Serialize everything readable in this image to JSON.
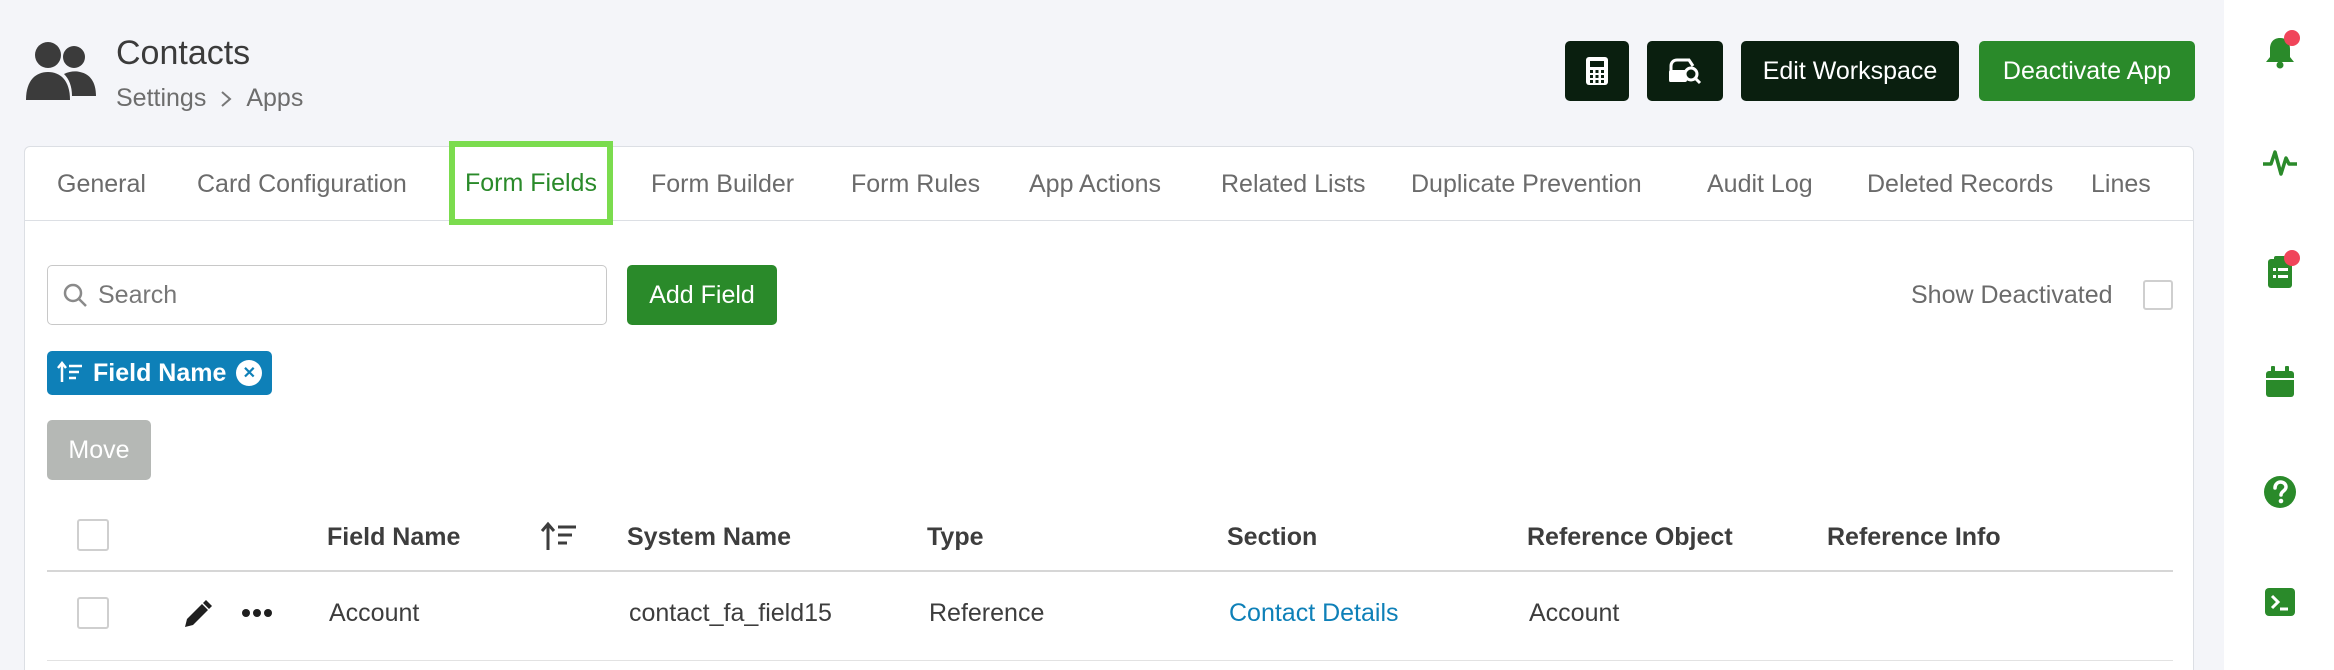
{
  "header": {
    "title": "Contacts",
    "breadcrumb": [
      "Settings",
      "Apps"
    ],
    "buttons": {
      "edit_workspace": "Edit Workspace",
      "deactivate_app": "Deactivate App"
    }
  },
  "tabs": [
    {
      "label": "General",
      "active": false
    },
    {
      "label": "Card Configuration",
      "active": false
    },
    {
      "label": "Form Fields",
      "active": true
    },
    {
      "label": "Form Builder",
      "active": false
    },
    {
      "label": "Form Rules",
      "active": false
    },
    {
      "label": "App Actions",
      "active": false
    },
    {
      "label": "Related Lists",
      "active": false
    },
    {
      "label": "Duplicate Prevention",
      "active": false
    },
    {
      "label": "Audit Log",
      "active": false
    },
    {
      "label": "Deleted Records",
      "active": false
    },
    {
      "label": "Lines",
      "active": false
    }
  ],
  "toolbar": {
    "search_placeholder": "Search",
    "search_value": "",
    "add_field": "Add Field",
    "show_deactivated": "Show Deactivated",
    "show_deactivated_checked": false
  },
  "sort_chip": {
    "label": "Field Name"
  },
  "move_button": "Move",
  "table": {
    "columns": [
      "Field Name",
      "System Name",
      "Type",
      "Section",
      "Reference Object",
      "Reference Info"
    ],
    "rows": [
      {
        "field_name": "Account",
        "system_name": "contact_fa_field15",
        "type": "Reference",
        "section": "Contact Details",
        "reference_object": "Account",
        "reference_info": ""
      }
    ]
  },
  "right_sidebar": {
    "icons": [
      "bell-icon",
      "activity-icon",
      "tasks-icon",
      "calendar-icon",
      "help-icon",
      "terminal-icon"
    ],
    "badges": [
      "bell-icon",
      "tasks-icon"
    ]
  },
  "colors": {
    "brand_green": "#2a8a2a",
    "dark_button": "#0a1f0f",
    "link_blue": "#0e80b8",
    "tab_highlight": "#7bdc4e",
    "badge_red": "#f0455a"
  }
}
